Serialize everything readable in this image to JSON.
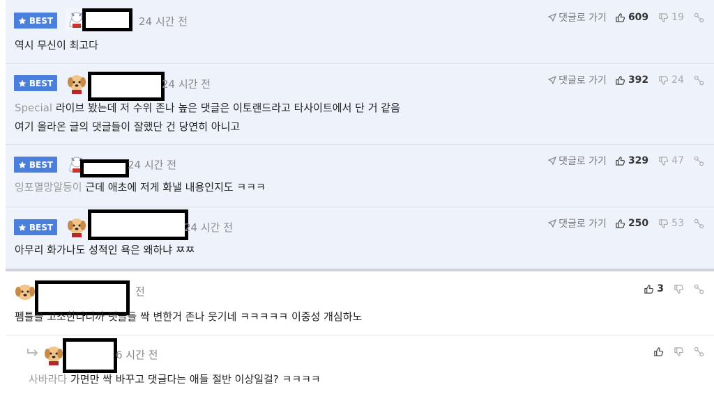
{
  "labels": {
    "best": "BEST",
    "goto_comment": "댓글로 가기"
  },
  "comments": [
    {
      "time": "24 시간 전",
      "prefix": "",
      "lines": [
        "역시 무신이 최고다"
      ],
      "likes": "609",
      "dislikes": "19"
    },
    {
      "time": "24 시간 전",
      "prefix": "Special",
      "lines": [
        "라이브 봤는데 저 수위 존나 높은 댓글은 이토랜드라고 타사이트에서 단 거 같음",
        "여기 올라온 글의 댓글들이 잘했단 건 당연히 아니고"
      ],
      "likes": "392",
      "dislikes": "24"
    },
    {
      "time": "24 시간 전",
      "prefix": "잉포멸망알등이",
      "lines": [
        "근데 애초에 저게 화낼 내용인지도 ㅋㅋㅋ"
      ],
      "likes": "329",
      "dislikes": "47"
    },
    {
      "time": "24 시간 전",
      "prefix": "",
      "lines": [
        "아무리 화가나도 성적인 욕은 왜하냐 ㅉㅉ"
      ],
      "likes": "250",
      "dislikes": "53"
    },
    {
      "time": "전",
      "prefix": "",
      "lines": [
        "펨틀을 고소한다니까 댓글들 싹 변한거 존나 웃기네 ㅋㅋㅋㅋㅋ 이중성 개심하노"
      ],
      "likes": "3",
      "dislikes": ""
    },
    {
      "time": "6 시간 전",
      "prefix": "사바라다",
      "lines": [
        "가면만 싹 바꾸고 댓글다는 애들 절반 이상일걸? ㅋㅋㅋㅋ"
      ],
      "likes": "",
      "dislikes": ""
    }
  ],
  "colors": {
    "best_badge": "#4a7fdc",
    "best_row_bg": "#eef2fa"
  }
}
